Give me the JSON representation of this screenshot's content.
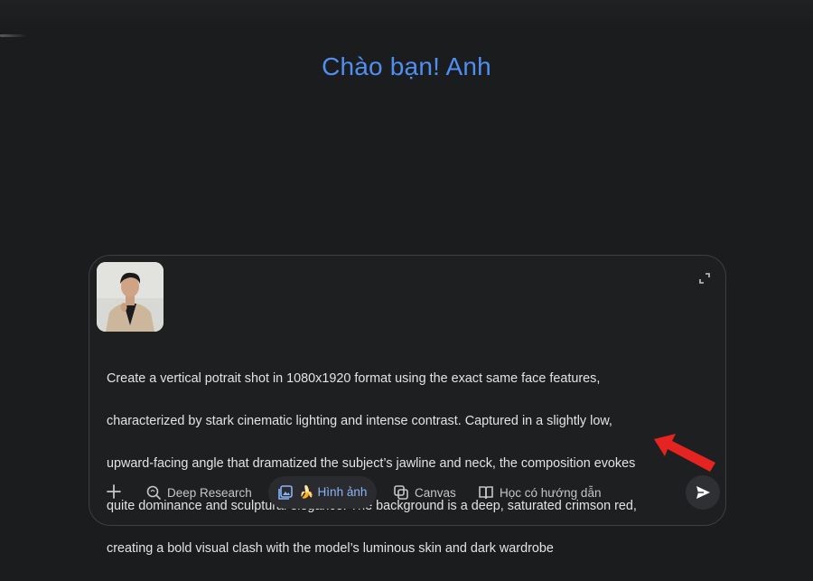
{
  "greeting": "Chào bạn! Anh",
  "composer": {
    "prompt_lines": [
      "Create a vertical potrait shot in 1080x1920 format using the exact same face features,",
      "characterized by stark cinematic lighting and intense contrast. Captured in a slightly low,",
      "upward-facing angle that dramatized the subject’s jawline and neck, the composition evokes",
      "quite dominance and sculptural elegance. The background is a deep, saturated crimson red,",
      "creating a bold visual clash with the model’s luminous skin and dark wardrobe"
    ],
    "attachment_icon": "portrait-photo",
    "expand_icon": "expand-icon"
  },
  "toolbar": {
    "tools": [
      {
        "label": "Deep Research",
        "icon": "deep-research-icon"
      },
      {
        "label": "🍌 Hình ảnh",
        "icon": "image-icon",
        "active": true
      },
      {
        "label": "Canvas",
        "icon": "canvas-icon"
      },
      {
        "label": "Học có hướng dẫn",
        "icon": "guided-learning-icon"
      }
    ],
    "add_icon": "plus-icon",
    "send_icon": "send-icon"
  },
  "colors": {
    "background": "#1b1c1d",
    "greeting": "#4f8ff2",
    "active_tool": "#8ab4f8",
    "annotation_arrow": "#e52421"
  }
}
